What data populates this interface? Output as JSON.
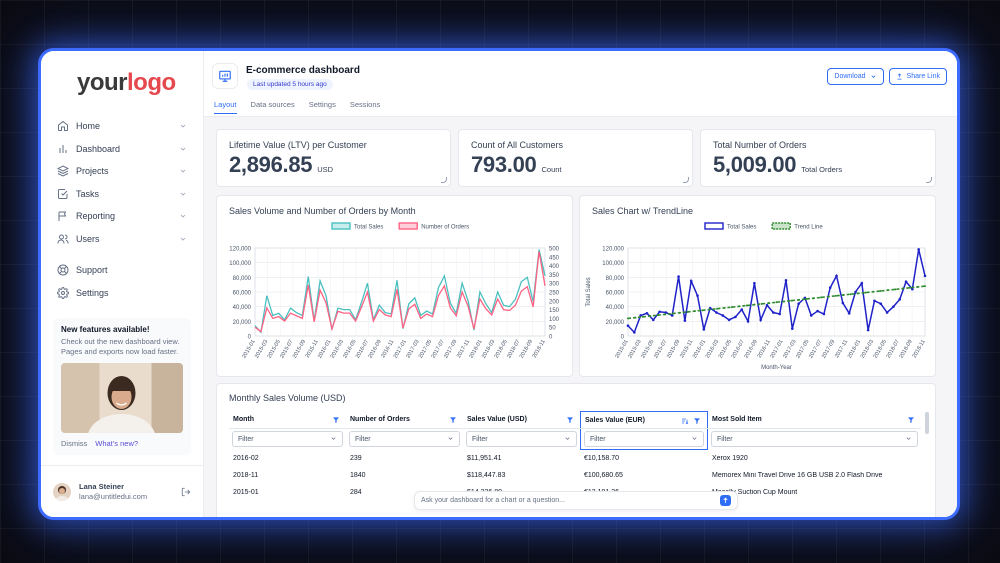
{
  "logo": {
    "part1": "your",
    "part2": "logo"
  },
  "sidebar": {
    "items": [
      {
        "label": "Home",
        "icon": "home-icon",
        "has_chevron": true
      },
      {
        "label": "Dashboard",
        "icon": "bar-chart-icon",
        "has_chevron": true
      },
      {
        "label": "Projects",
        "icon": "layers-icon",
        "has_chevron": true
      },
      {
        "label": "Tasks",
        "icon": "check-square-icon",
        "has_chevron": true
      },
      {
        "label": "Reporting",
        "icon": "flag-icon",
        "has_chevron": true
      },
      {
        "label": "Users",
        "icon": "users-icon",
        "has_chevron": true
      }
    ],
    "footer_items": [
      {
        "label": "Support",
        "icon": "life-buoy-icon"
      },
      {
        "label": "Settings",
        "icon": "gear-icon"
      }
    ],
    "promo": {
      "title": "New features available!",
      "text": "Check out the new dashboard view. Pages and exports now load faster.",
      "dismiss": "Dismiss",
      "whats_new": "What’s new?"
    },
    "user": {
      "name": "Lana Steiner",
      "email": "lana@untitledui.com"
    }
  },
  "header": {
    "title": "E-commerce dashboard",
    "badge": "Last updated 5 hours ago",
    "download_label": "Download",
    "share_label": "Share Link",
    "tabs": [
      {
        "label": "Layout",
        "active": true
      },
      {
        "label": "Data sources",
        "active": false
      },
      {
        "label": "Settings",
        "active": false
      },
      {
        "label": "Sessions",
        "active": false
      }
    ]
  },
  "kpis": [
    {
      "label": "Lifetime Value (LTV) per Customer",
      "value": "2,896.85",
      "unit": "USD"
    },
    {
      "label": "Count of All Customers",
      "value": "793.00",
      "unit": "Count"
    },
    {
      "label": "Total Number of Orders",
      "value": "5,009.00",
      "unit": "Total Orders"
    }
  ],
  "colors": {
    "accent": "#2f6df6",
    "teal": "#4bc0c0",
    "pink": "#ff6384",
    "navy": "#1f22c8",
    "trend": "#2e8b2e"
  },
  "chart_data": [
    {
      "type": "line",
      "title": "Sales Volume and Number of Orders by Month",
      "x_tick_labels": [
        "2015-01",
        "2015-03",
        "2015-05",
        "2015-07",
        "2015-09",
        "2015-11",
        "2016-01",
        "2016-03",
        "2016-05",
        "2016-07",
        "2016-09",
        "2016-11",
        "2017-01",
        "2017-03",
        "2017-05",
        "2017-07",
        "2017-09",
        "2017-11",
        "2018-01",
        "2018-03",
        "2018-05",
        "2018-07",
        "2018-09",
        "2018-11"
      ],
      "series": [
        {
          "name": "Total Sales",
          "axis": "left",
          "values": [
            14000,
            5000,
            55000,
            28000,
            31000,
            22000,
            38000,
            32000,
            28000,
            81000,
            21000,
            75000,
            55000,
            9000,
            38000,
            36000,
            36000,
            22000,
            46000,
            72000,
            22000,
            42000,
            32000,
            30000,
            76000,
            10000,
            44000,
            52000,
            28000,
            34000,
            30000,
            66000,
            82000,
            45000,
            31000,
            72000,
            48000,
            8000,
            60000,
            44000,
            32000,
            60000,
            42000,
            40000,
            50000,
            74000,
            80000,
            47000,
            118000,
            82000
          ]
        },
        {
          "name": "Number of Orders",
          "axis": "right",
          "values": [
            50,
            25,
            160,
            100,
            110,
            85,
            130,
            115,
            100,
            290,
            80,
            260,
            190,
            40,
            140,
            130,
            130,
            85,
            165,
            250,
            85,
            150,
            120,
            110,
            265,
            45,
            155,
            180,
            100,
            125,
            110,
            230,
            285,
            160,
            115,
            250,
            170,
            40,
            210,
            155,
            120,
            210,
            150,
            145,
            175,
            255,
            280,
            165,
            480,
            285
          ]
        }
      ],
      "y_left": {
        "ticks": [
          "0",
          "20,000",
          "40,000",
          "60,000",
          "80,000",
          "100,000",
          "120,000"
        ],
        "min": 0,
        "max": 120000
      },
      "y_right": {
        "ticks": [
          "0",
          "50",
          "100",
          "150",
          "200",
          "250",
          "300",
          "350",
          "400",
          "450",
          "500"
        ],
        "min": 0,
        "max": 500
      },
      "legend_position": "top",
      "grid": true
    },
    {
      "type": "line",
      "title": "Sales Chart w/ TrendLine",
      "x_tick_labels": [
        "2015-01",
        "2015-03",
        "2015-05",
        "2015-07",
        "2015-09",
        "2015-11",
        "2016-01",
        "2016-03",
        "2016-05",
        "2016-07",
        "2016-09",
        "2016-11",
        "2017-01",
        "2017-03",
        "2017-05",
        "2017-07",
        "2017-09",
        "2017-11",
        "2018-01",
        "2018-03",
        "2018-05",
        "2018-07",
        "2018-09",
        "2018-11"
      ],
      "xlabel": "Month-Year",
      "ylabel": "Total Sales",
      "series": [
        {
          "name": "Total Sales",
          "values": [
            14000,
            5000,
            28000,
            31000,
            22000,
            33000,
            32000,
            28000,
            81000,
            21000,
            75000,
            55000,
            9000,
            38000,
            32000,
            28000,
            22000,
            26000,
            36000,
            20000,
            72000,
            22000,
            42000,
            32000,
            30000,
            76000,
            10000,
            44000,
            52000,
            28000,
            34000,
            30000,
            66000,
            82000,
            45000,
            31000,
            60000,
            72000,
            8000,
            48000,
            44000,
            32000,
            40000,
            50000,
            74000,
            64000,
            118000,
            82000
          ]
        },
        {
          "name": "Trend Line",
          "style": "dashed",
          "start": 24000,
          "end": 68000
        }
      ],
      "y_axis": {
        "ticks": [
          "0",
          "20,000",
          "40,000",
          "60,000",
          "80,000",
          "100,000",
          "120,000"
        ],
        "min": 0,
        "max": 120000
      },
      "legend_position": "top",
      "grid": true
    }
  ],
  "table": {
    "title": "Monthly Sales Volume (USD)",
    "columns": [
      {
        "label": "Month",
        "selected": false,
        "sort_icon": false
      },
      {
        "label": "Number of Orders",
        "selected": false,
        "sort_icon": false
      },
      {
        "label": "Sales Value (USD)",
        "selected": false,
        "sort_icon": false
      },
      {
        "label": "Sales Value (EUR)",
        "selected": true,
        "sort_icon": true
      },
      {
        "label": "Most Sold Item",
        "selected": false,
        "sort_icon": false
      }
    ],
    "filter_placeholder": "Filter",
    "rows": [
      [
        "2016-02",
        "239",
        "$11,951.41",
        "€10,158.70",
        "Xerox 1920"
      ],
      [
        "2018-11",
        "1840",
        "$118,447.83",
        "€100,680.65",
        "Memorex Mini Travel Drive 16 GB USB 2.0 Flash Drive"
      ],
      [
        "2015-01",
        "284",
        "$14,236.89",
        "€12,101.36",
        "Macally Suction Cup Mount"
      ]
    ]
  },
  "ask": {
    "placeholder": "Ask your dashboard for a chart or a question..."
  }
}
